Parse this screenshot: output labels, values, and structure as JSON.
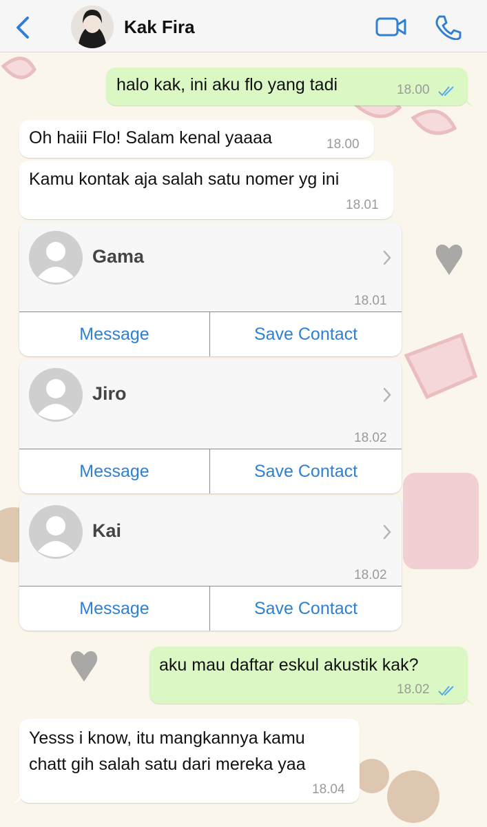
{
  "header": {
    "contact_name": "Kak Fira",
    "back_icon": "chevron-left-icon",
    "video_icon": "video-camera-icon",
    "call_icon": "phone-icon",
    "accent_color": "#2f7fd2"
  },
  "messages": [
    {
      "direction": "out",
      "text": "halo kak, ini aku flo yang tadi",
      "time": "18.00",
      "read": true
    },
    {
      "direction": "in",
      "text": "Oh haiii Flo! Salam kenal yaaaa",
      "time": "18.00"
    },
    {
      "direction": "in",
      "text": "Kamu kontak aja salah satu nomer yg ini",
      "time": "18.01"
    },
    {
      "direction": "out",
      "text": "aku mau daftar eskul akustik kak?",
      "time": "18.02",
      "read": true
    },
    {
      "direction": "in",
      "text_lines": [
        "Yesss i know, itu mangkannya kamu",
        "chatt gih salah satu dari mereka yaa"
      ],
      "time": "18.04"
    }
  ],
  "contacts": [
    {
      "name": "Gama",
      "time": "18.01",
      "message_label": "Message",
      "save_label": "Save Contact"
    },
    {
      "name": "Jiro",
      "time": "18.02",
      "message_label": "Message",
      "save_label": "Save Contact"
    },
    {
      "name": "Kai",
      "time": "18.02",
      "message_label": "Message",
      "save_label": "Save Contact"
    }
  ],
  "colors": {
    "outgoing_bubble": "#dbf7c4",
    "incoming_bubble": "#ffffff",
    "wallpaper": "#fbf6ec",
    "read_ticks": "#5aa9e6"
  }
}
